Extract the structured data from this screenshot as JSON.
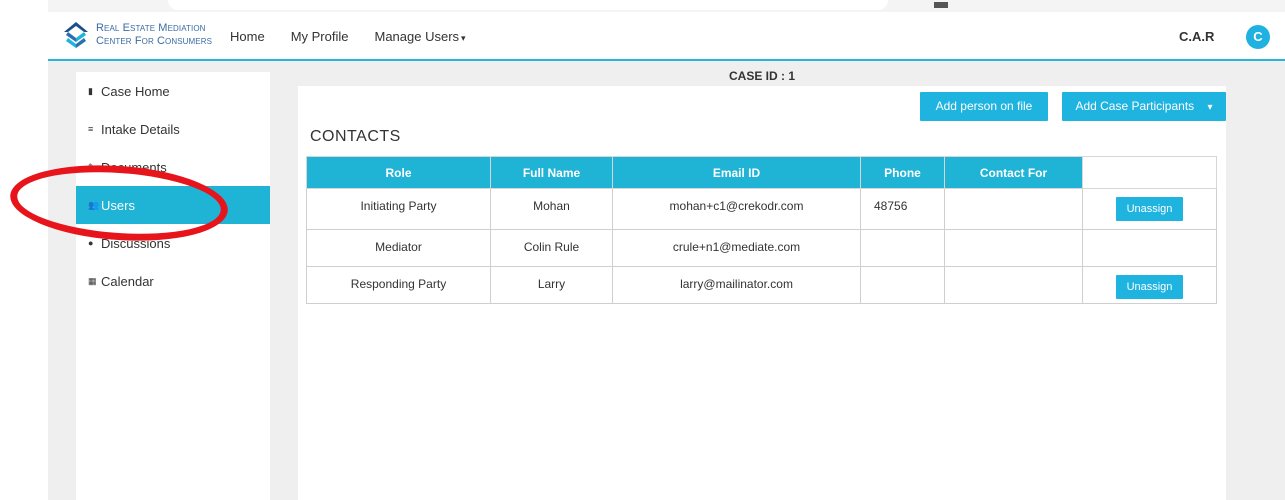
{
  "brand": {
    "line1": "Real Estate Mediation",
    "line2": "Center For Consumers"
  },
  "nav": {
    "home": "Home",
    "profile": "My Profile",
    "manage_users": "Manage Users",
    "caret": "▾"
  },
  "user": {
    "abbr": "C.A.R",
    "avatar_initial": "C"
  },
  "sidebar": {
    "items": [
      {
        "label": "Case Home",
        "icon": "▮"
      },
      {
        "label": "Intake Details",
        "icon": "≡"
      },
      {
        "label": "Documents",
        "icon": "✎"
      },
      {
        "label": "Users",
        "icon": "👥"
      },
      {
        "label": "Discussions",
        "icon": "●"
      },
      {
        "label": "Calendar",
        "icon": "▦"
      }
    ],
    "active": "Users"
  },
  "case": {
    "title": "CASE ID : 1"
  },
  "buttons": {
    "add_person": "Add person on file",
    "add_participants": "Add Case Participants",
    "dropdown_caret": "▾"
  },
  "contacts": {
    "title": "CONTACTS",
    "headers": [
      "Role",
      "Full Name",
      "Email ID",
      "Phone",
      "Contact For"
    ],
    "rows": [
      {
        "role": "Initiating Party",
        "name": "Mohan",
        "email": "mohan+c1@crekodr.com",
        "phone": "48756",
        "contact_for": "",
        "action": "Unassign"
      },
      {
        "role": "Mediator",
        "name": "Colin Rule",
        "email": "crule+n1@mediate.com",
        "phone": "",
        "contact_for": "",
        "action": ""
      },
      {
        "role": "Responding Party",
        "name": "Larry",
        "email": "larry@mailinator.com",
        "phone": "",
        "contact_for": "",
        "action": "Unassign"
      }
    ]
  },
  "colors": {
    "accent": "#1fb3d5",
    "annotation": "#e8141b",
    "brand_text": "#3b6ba5"
  }
}
